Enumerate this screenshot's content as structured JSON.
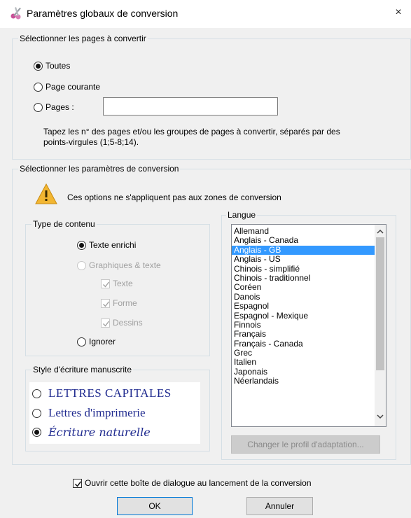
{
  "window": {
    "title": "Paramètres globaux de conversion",
    "close_glyph": "×",
    "icon": "scissors-app-icon"
  },
  "pages_group": {
    "legend": "Sélectionner les pages à convertir",
    "options": [
      {
        "label": "Toutes",
        "checked": true
      },
      {
        "label": "Page courante",
        "checked": false
      },
      {
        "label": "Pages :",
        "checked": false
      }
    ],
    "pages_input_value": "",
    "hint_line1": "Tapez les n° des pages et/ou les groupes de pages à convertir, séparés par des",
    "hint_line2": "points-virgules (1;5-8;14)."
  },
  "conversion_group": {
    "legend": "Sélectionner les paramètres de conversion",
    "warning_text": "Ces options ne s'appliquent pas aux zones de conversion",
    "warning_icon": "warning-triangle-icon"
  },
  "content_type": {
    "legend": "Type de contenu",
    "rich_text": "Texte enrichi",
    "graphics_text": "Graphiques & texte",
    "text_label": "Texte",
    "shape_label": "Forme",
    "drawing_label": "Dessins",
    "ignore_label": "Ignorer"
  },
  "handwriting": {
    "legend": "Style d'écriture manuscrite",
    "capitals": "LETTRES CAPITALES",
    "print": "Lettres d'imprimerie",
    "cursive": "Écriture naturelle"
  },
  "language": {
    "legend": "Langue",
    "items": [
      "Allemand",
      "Anglais - Canada",
      "Anglais - GB",
      "Anglais - US",
      "Chinois - simplifié",
      "Chinois - traditionnel",
      "Coréen",
      "Danois",
      "Espagnol",
      "Espagnol - Mexique",
      "Finnois",
      "Français",
      "Français - Canada",
      "Grec",
      "Italien",
      "Japonais",
      "Néerlandais"
    ],
    "selected": "Anglais - GB",
    "profile_button": "Changer le profil d'adaptation..."
  },
  "footer": {
    "open_dialog_checkbox": "Ouvrir cette boîte de dialogue au lancement de la conversion",
    "ok": "OK",
    "cancel": "Annuler"
  },
  "colors": {
    "selection": "#3399ff",
    "handwriting_text": "#1f2a8f"
  }
}
